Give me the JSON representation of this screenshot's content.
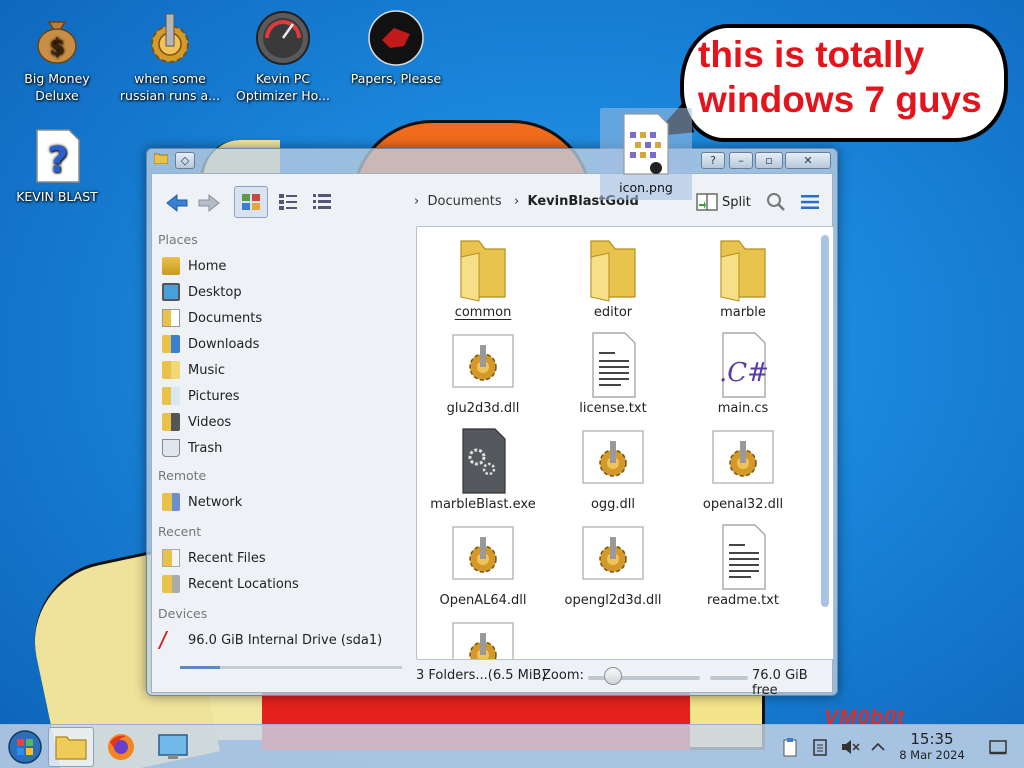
{
  "desktop": {
    "icons": [
      {
        "label": "Big Money Deluxe",
        "icon": "money-bag-icon"
      },
      {
        "label": "when some russian runs a...",
        "icon": "gear-icon"
      },
      {
        "label": "Kevin PC Optimizer Ho...",
        "icon": "gauge-icon"
      },
      {
        "label": "Papers, Please",
        "icon": "papers-please-icon"
      },
      {
        "label": "KEVIN BLAST",
        "icon": "question-file-icon"
      }
    ],
    "speech_bubble": "this is totally windows 7 guys",
    "vm_label": "VM0b0t",
    "colors": {
      "sky": "#1a87dc",
      "bubble_text": "#e4141d"
    }
  },
  "window": {
    "toolbar": {
      "breadcrumb": [
        "Documents",
        "KevinBlastGold"
      ],
      "split_label": "Split"
    },
    "places": {
      "sections": [
        {
          "title": "Places",
          "items": [
            "Home",
            "Desktop",
            "Documents",
            "Downloads",
            "Music",
            "Pictures",
            "Videos",
            "Trash"
          ]
        },
        {
          "title": "Remote",
          "items": [
            "Network"
          ]
        },
        {
          "title": "Recent",
          "items": [
            "Recent Files",
            "Recent Locations"
          ]
        },
        {
          "title": "Devices",
          "items": [
            "96.0 GiB Internal Drive (sda1)"
          ]
        }
      ]
    },
    "files": [
      {
        "name": "common",
        "type": "folder"
      },
      {
        "name": "editor",
        "type": "folder"
      },
      {
        "name": "marble",
        "type": "folder"
      },
      {
        "name": "glu2d3d.dll",
        "type": "dll"
      },
      {
        "name": "license.txt",
        "type": "text"
      },
      {
        "name": "main.cs",
        "type": "csharp"
      },
      {
        "name": "marbleBlast.exe",
        "type": "exe"
      },
      {
        "name": "ogg.dll",
        "type": "dll"
      },
      {
        "name": "openal32.dll",
        "type": "dll"
      },
      {
        "name": "OpenAL64.dll",
        "type": "dll"
      },
      {
        "name": "opengl2d3d.dll",
        "type": "dll"
      },
      {
        "name": "readme.txt",
        "type": "text"
      }
    ],
    "dragged_file": "icon.png",
    "status": {
      "summary": "3 Folders...(6.5 MiB)",
      "zoom_label": "Zoom:",
      "free_space": "76.0 GiB free"
    }
  },
  "taskbar": {
    "clock_time": "15:35",
    "clock_date": "8 Mar 2024"
  }
}
